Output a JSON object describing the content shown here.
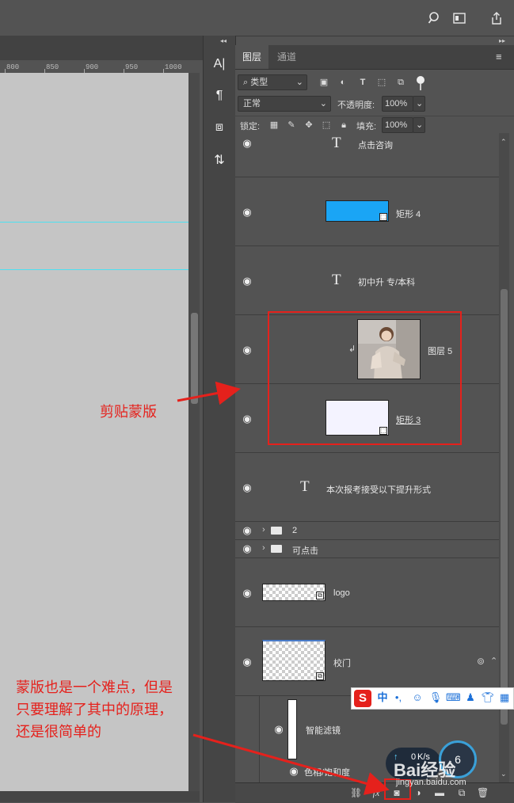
{
  "ruler": {
    "ticks": [
      "800",
      "850",
      "900",
      "950",
      "1000"
    ]
  },
  "toolbar_icons": [
    "character-icon",
    "paragraph-icon",
    "3d-icon",
    "timeline-icon"
  ],
  "panel": {
    "tabs": [
      "图层",
      "通道"
    ],
    "filter_type": "类型",
    "blend_mode": "正常",
    "opacity_label": "不透明度:",
    "opacity_value": "100%",
    "lock_label": "锁定:",
    "fill_label": "填充:",
    "fill_value": "100%"
  },
  "layers": [
    {
      "name": "点击咨询",
      "kind": "text"
    },
    {
      "name": "矩形 4",
      "kind": "shape",
      "color": "#1aa5f5"
    },
    {
      "name": "初中升 专/本科",
      "kind": "text"
    },
    {
      "name": "图层 5",
      "kind": "image",
      "clipped": true
    },
    {
      "name": "矩形 3",
      "kind": "shape",
      "color": "#f4f3ff"
    },
    {
      "name": "本次报考接受以下提升形式",
      "kind": "text"
    },
    {
      "name": "2",
      "kind": "group"
    },
    {
      "name": "可点击",
      "kind": "group"
    },
    {
      "name": "logo",
      "kind": "smart"
    },
    {
      "name": "校门",
      "kind": "smart"
    },
    {
      "name": "智能滤镜",
      "kind": "filter"
    },
    {
      "name": "色相/饱和度",
      "kind": "filter-item"
    }
  ],
  "annotations": {
    "clip_mask": "剪贴蒙版",
    "note_line1": "蒙版也是一个难点，但是",
    "note_line2": "只要理解了其中的原理，",
    "note_line3": "还是很简单的",
    "accent_color": "#e5211c"
  },
  "ime": {
    "mode": "中"
  },
  "speed": {
    "value": "0",
    "unit": "K/s"
  },
  "watermark": {
    "brand": "Bai经验",
    "url": "jingyan.baidu.com"
  }
}
